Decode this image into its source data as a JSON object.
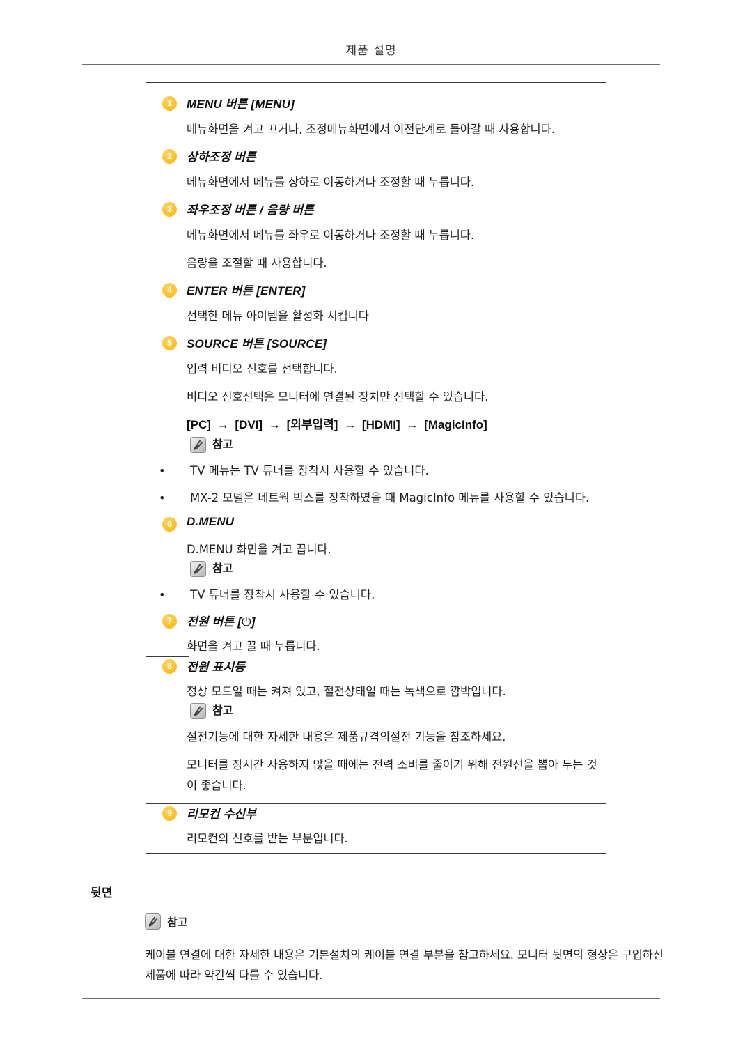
{
  "header": {
    "title": "제품 설명"
  },
  "items": [
    {
      "number": "1",
      "title": "MENU 버튼 [MENU]",
      "body": "메뉴화면을 켜고 끄거나, 조정메뉴화면에서 이전단계로 돌아갈 때 사용합니다."
    },
    {
      "number": "2",
      "title": "상하조정 버튼",
      "body": "메뉴화면에서 메뉴를 상하로 이동하거나 조정할 때 누릅니다."
    },
    {
      "number": "3",
      "title": "좌우조정 버튼 / 음량 버튼",
      "body": "메뉴화면에서 메뉴를 좌우로 이동하거나 조정할 때 누릅니다.",
      "body2": "음량을 조절할 때 사용합니다."
    },
    {
      "number": "4",
      "title": "ENTER 버튼 [ENTER]",
      "body": "선택한 메뉴 아이템을 활성화 시킵니다"
    },
    {
      "number": "5",
      "title": "SOURCE 버튼 [SOURCE]",
      "body": "입력 비디오 신호를 선택합니다.",
      "body2": "비디오 신호선택은 모니터에 연결된 장치만 선택할 수 있습니다."
    },
    {
      "number": "6",
      "title": "D.MENU",
      "body": "D.MENU 화면을 켜고 끕니다."
    },
    {
      "number": "7",
      "title_prefix": "전원 버튼 [",
      "title_icon": "⏻",
      "title_suffix": "]",
      "body": "화면을 켜고 끌 때 누릅니다."
    },
    {
      "number": "8",
      "title": "전원 표시등",
      "body": "정상 모드일 때는 켜져 있고, 절전상태일 때는 녹색으로 깜박입니다."
    },
    {
      "number": "9",
      "title": "리모컨 수신부",
      "body": "리모컨의 신호를 받는 부분입니다."
    }
  ],
  "source_route": {
    "tokens": [
      "[PC]",
      "[DVI]",
      "[외부입력]",
      "[HDMI]",
      "[MagicInfo]"
    ],
    "arrow": "→"
  },
  "note": {
    "label": "참고",
    "icon": "note-hand-icon"
  },
  "source_notes": [
    "TV 메뉴는 TV 튜너를 장착시 사용할 수 있습니다.",
    "MX-2 모델은 네트웍 박스를 장착하였을 때 MagicInfo 메뉴를 사용할 수 있습니다."
  ],
  "dmenu_notes": [
    "TV 튜너를 장착시 사용할 수 있습니다."
  ],
  "power_notes": [
    "절전기능에 대한 자세한 내용은 제품규격의절전 기능을 참조하세요.",
    "모니터를 장시간 사용하지 않을 때에는 전력 소비를 줄이기 위해 전원선을 뽑아 두는 것이 좋습니다."
  ],
  "bottom": {
    "title": "뒷면",
    "note_label": "참고",
    "paragraph": "케이블 연결에 대한 자세한 내용은 기본설치의 케이블 연결 부분을 참고하세요. 모니터 뒷면의 형상은 구입하신 제품에 따라 약간씩 다를 수 있습니다."
  },
  "bullet_char": "•",
  "colors": {
    "badge": "#ffc22e",
    "rule": "#3a3a3a",
    "header_rule": "#6b6b70",
    "text": "#1f1f1f"
  }
}
